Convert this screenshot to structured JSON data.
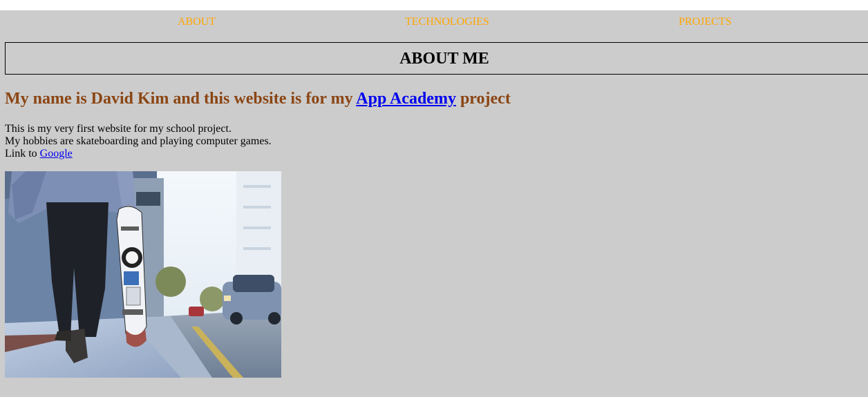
{
  "nav": {
    "items": [
      {
        "label": "ABOUT"
      },
      {
        "label": "TECHNOLOGIES"
      },
      {
        "label": "PROJECTS"
      }
    ],
    "link_color": "#ffa500"
  },
  "about": {
    "title": "ABOUT ME",
    "intro_prefix": "My name is David Kim and this website is for my",
    "intro_link": "App Academy",
    "intro_suffix": "project",
    "intro_color": "#8b4513",
    "line1": "This is my very first website for my school project.",
    "line2": "My hobbies are skateboarding and playing computer games.",
    "line3_prefix": "Link to",
    "line3_link": "Google"
  },
  "photo": {
    "icon": "skateboarder-photo"
  },
  "colors": {
    "background": "#cccccc",
    "link": "#0000ee"
  }
}
